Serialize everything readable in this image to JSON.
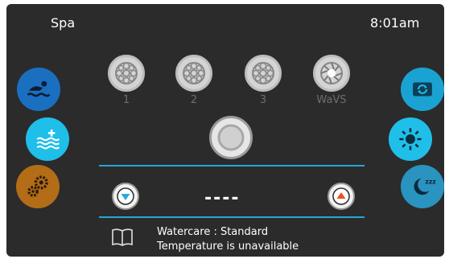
{
  "status_bar": {
    "title": "Spa",
    "time": "8:01am"
  },
  "left_buttons": [
    {
      "name": "swim-button",
      "icon": "swimmer-icon",
      "color": "#1a6fc0"
    },
    {
      "name": "heat-button",
      "icon": "water-plus-icon",
      "color": "#1fbfea"
    },
    {
      "name": "settings-button",
      "icon": "gears-icon",
      "color": "#b36d16"
    }
  ],
  "right_buttons": [
    {
      "name": "cycle-button",
      "icon": "sync-icon",
      "color": "#1aa3d2"
    },
    {
      "name": "light-button",
      "icon": "brightness-icon",
      "color": "#1fbfea"
    },
    {
      "name": "sleep-button",
      "icon": "moon-sleep-icon",
      "color": "#2a93bf"
    }
  ],
  "pumps": [
    {
      "label": "1",
      "icon": "jet-icon"
    },
    {
      "label": "2",
      "icon": "jet-icon"
    },
    {
      "label": "3",
      "icon": "jet-icon"
    },
    {
      "label": "WaVS",
      "icon": "wave-jet-icon"
    }
  ],
  "center_button_icon": "ring-icon",
  "temperature": {
    "display": "----",
    "down_icon": "triangle-down-icon",
    "up_icon": "triangle-up-icon",
    "down_color": "#2aa9dc",
    "up_color": "#e8531f"
  },
  "info": {
    "icon": "book-icon",
    "watercare": "Watercare : Standard",
    "temperature_status": "Temperature is unavailable"
  },
  "colors": {
    "accent": "#25a6d9",
    "background": "#2b2b2b"
  }
}
